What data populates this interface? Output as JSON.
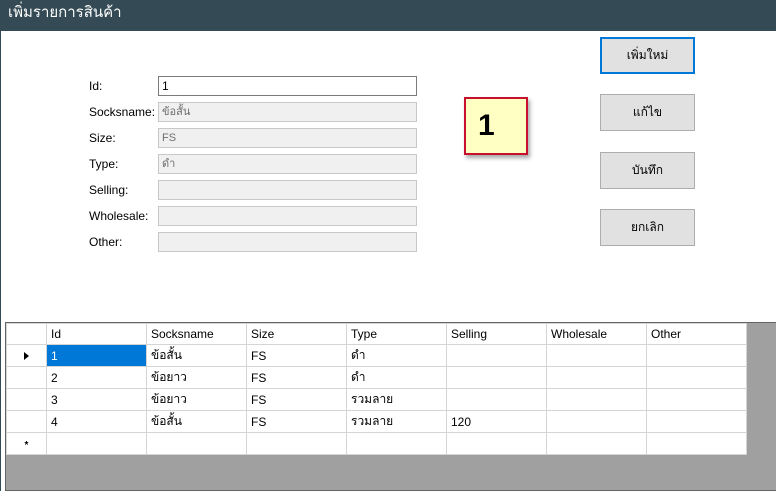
{
  "window": {
    "title": "เพิ่มรายการสินค้า"
  },
  "form": {
    "fields": [
      {
        "label": "Id:",
        "value": "1"
      },
      {
        "label": "Socksname:",
        "value": "ข้อสั้น"
      },
      {
        "label": "Size:",
        "value": "FS"
      },
      {
        "label": "Type:",
        "value": "ดำ"
      },
      {
        "label": "Selling:",
        "value": ""
      },
      {
        "label": "Wholesale:",
        "value": ""
      },
      {
        "label": "Other:",
        "value": ""
      }
    ]
  },
  "buttons": {
    "add": "เพิ่มใหม่",
    "edit": "แก้ไข",
    "save": "บันทึก",
    "cancel": "ยกเลิก"
  },
  "badge": {
    "text": "1"
  },
  "grid": {
    "columns": [
      "Id",
      "Socksname",
      "Size",
      "Type",
      "Selling",
      "Wholesale",
      "Other"
    ],
    "rows": [
      [
        "1",
        "ข้อสั้น",
        "FS",
        "ดำ",
        "",
        "",
        ""
      ],
      [
        "2",
        "ข้อยาว",
        "FS",
        "ดำ",
        "",
        "",
        ""
      ],
      [
        "3",
        "ข้อยาว",
        "FS",
        "รวมลาย",
        "",
        "",
        ""
      ],
      [
        "4",
        "ข้อสั้น",
        "FS",
        "รวมลาย",
        "120",
        "",
        ""
      ]
    ],
    "new_row_marker": "*",
    "current_row_icon": "row-pointer-icon",
    "selection_color": "#0078d7"
  },
  "colors": {
    "titlebar": "#344a54",
    "badge_border": "#c8102e",
    "badge_fill": "#ffffc4"
  }
}
